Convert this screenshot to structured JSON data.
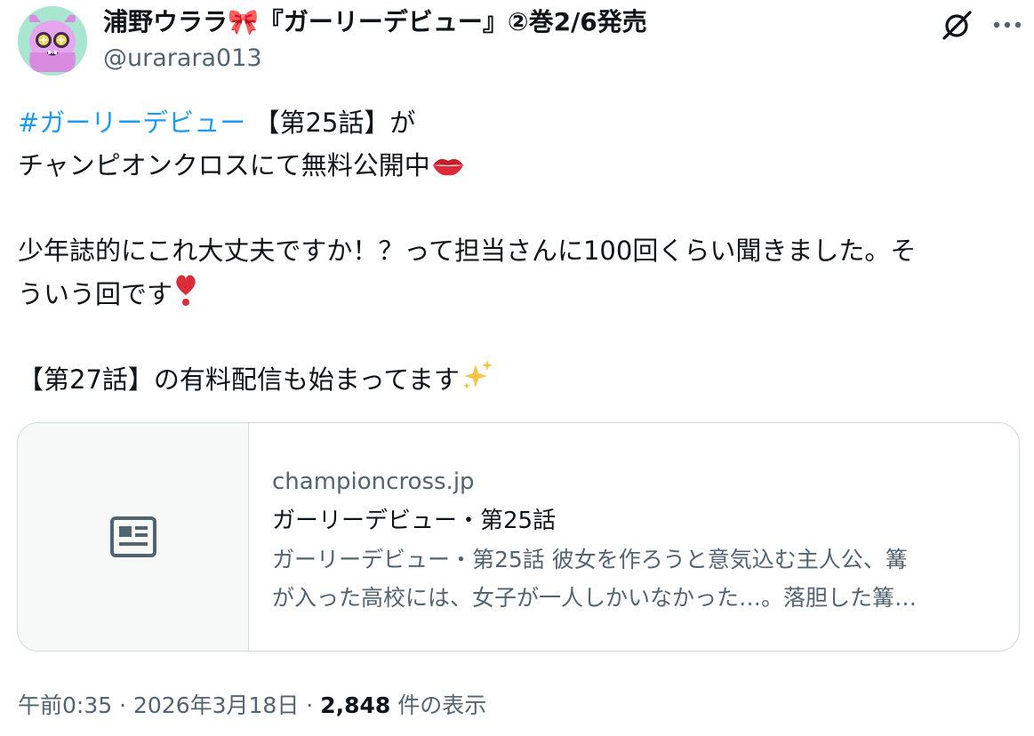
{
  "header": {
    "display_name": "浦野ウララ🎀『ガーリーデビュー』②巻2/6発売",
    "handle": "@urarara013"
  },
  "tweet": {
    "hashtag": "#ガーリーデビュー",
    "line1_rest": " 【第25話】が",
    "line2": "チャンピオンクロスにて無料公開中",
    "line2_emoji": "💋",
    "line3": "少年誌的にこれ大丈夫ですか！？って担当さんに100回くらい聞きました。そ",
    "line4": "ういう回です",
    "line4_emoji": "❣",
    "line5": "【第27話】の有料配信も始まってます",
    "line5_emoji": "✨"
  },
  "card": {
    "icon": "news-article-icon",
    "domain": "championcross.jp",
    "title": "ガーリーデビュー・第25話",
    "description_line1": "ガーリーデビュー・第25話 彼女を作ろうと意気込む主人公、篝",
    "description_line2": "が入った高校には、女子が一人しかいなかった…。落胆した篝…"
  },
  "meta": {
    "time": "午前0:35",
    "separator": "·",
    "date": "2026年3月18日",
    "views_count": "2,848",
    "views_label": " 件の表示"
  },
  "colors": {
    "link": "#1d9bf0",
    "secondary_text": "#536471",
    "border": "#cfd9de",
    "avatar_bg": "#a8e6cf"
  }
}
